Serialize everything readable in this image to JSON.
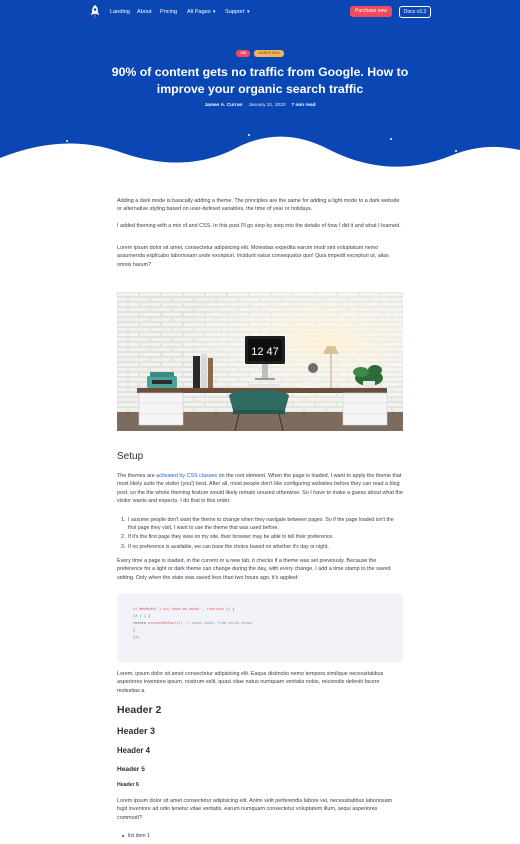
{
  "nav": {
    "links": [
      "Landing",
      "About",
      "Pricing"
    ],
    "all_pages": "All Pages",
    "support": "Support",
    "purchase": "Purchase now",
    "docs": "Docs v3.3"
  },
  "hero": {
    "tags": [
      "UNI",
      "MARKETING"
    ],
    "title": "90% of content gets no traffic from Google. How to improve your organic search traffic",
    "author": "James A. Curran",
    "date": "January 31, 2020",
    "read_time": "7 min read"
  },
  "article": {
    "p1": "Adding a dark mode is basically adding a theme. The principles are the same for adding a light mode to a dark website or alternative styling based on user-defined variables, the time of year or holidays.",
    "p2": "I added theming with a mix of and CSS. In this post I'll go step by step into the details of how I did it and what I learned.",
    "p3": "Lorem ipsum dolor sit amet, consectetur adipisicing elit. Molestias expedita earum modi sint voluptatum nemo assumenda explicabo laboriosam unde excepturi. Incidunt natus consequatur quo! Quia impedit excepturi ut, alias omnis harum?",
    "image_clock": "12 47",
    "setup_heading": "Setup",
    "setup_p1_before": "The themes are ",
    "setup_p1_link": "activated by CSS classes",
    "setup_p1_after": " on the root element. When the page is loaded, I want to apply the theme that most likely suits the visitor (you!) best. After all, most people don't like configuring websites before they can read a blog post, so the the whole theming feature would likely remain unused otherwise. So I have to make a guess about what the visitor wants and expects. I do that in this order:",
    "steps": [
      "I assume people don't want the theme to change when they navigate between pages. So if the page loaded isn't the first page they visit, I want to use the theme that was used before.",
      "If it's the first page they view on my site, their browser may be able to tell their preference.",
      "If no preference is available, we can base the choice based on whether it's day or night."
    ],
    "setup_p2": "Every time a page is loaded, in the current or a new tab, it checks if a theme was set previously. Because the preference for a light or dark theme can change during the day, with every change, I add a time stamp to the saved setting. Only when the state was saved less than two hours ago, it's applied:",
    "code": {
      "l1_sel": "$('#myModal').on('show.bs.modal', function",
      "l1_rest": "() {",
      "l2": "if (        ) {",
      "l3_kw": "return",
      "l3_fn": "preventDefault()",
      "l3_comment": "// stops modal from being shown",
      "l4": "}",
      "l5": "});"
    },
    "p4": "Lorem, ipsum dolor sit amet consectetur adipisicing elit. Eaque distinctio nemo tempora similique necessitatibus asperiores inventore ipsum, nostrum velit, quasi vitae natus numquam veritatis nobis, reiciendis deleniti facere molestias a.",
    "h2": "Header 2",
    "h3": "Header 3",
    "h4": "Header 4",
    "h5": "Header 5",
    "h6": "Header 6",
    "p5": "Lorem ipsum dolor sit amet consectetur adipisicing elit. Animi velit perferendis labore vel, necessitatibus laboriosam fugit inventore ad odio tenetur vitae veritatis, earum numquam consectetur voluptatem illum, sequi asperiores commodi?",
    "list_item": "list item 1"
  },
  "colors": {
    "hero_bg": "#0a47b4",
    "accent_red": "#ef4b5c",
    "link": "#1d5ed8",
    "code_bg": "#f1f3f8"
  }
}
